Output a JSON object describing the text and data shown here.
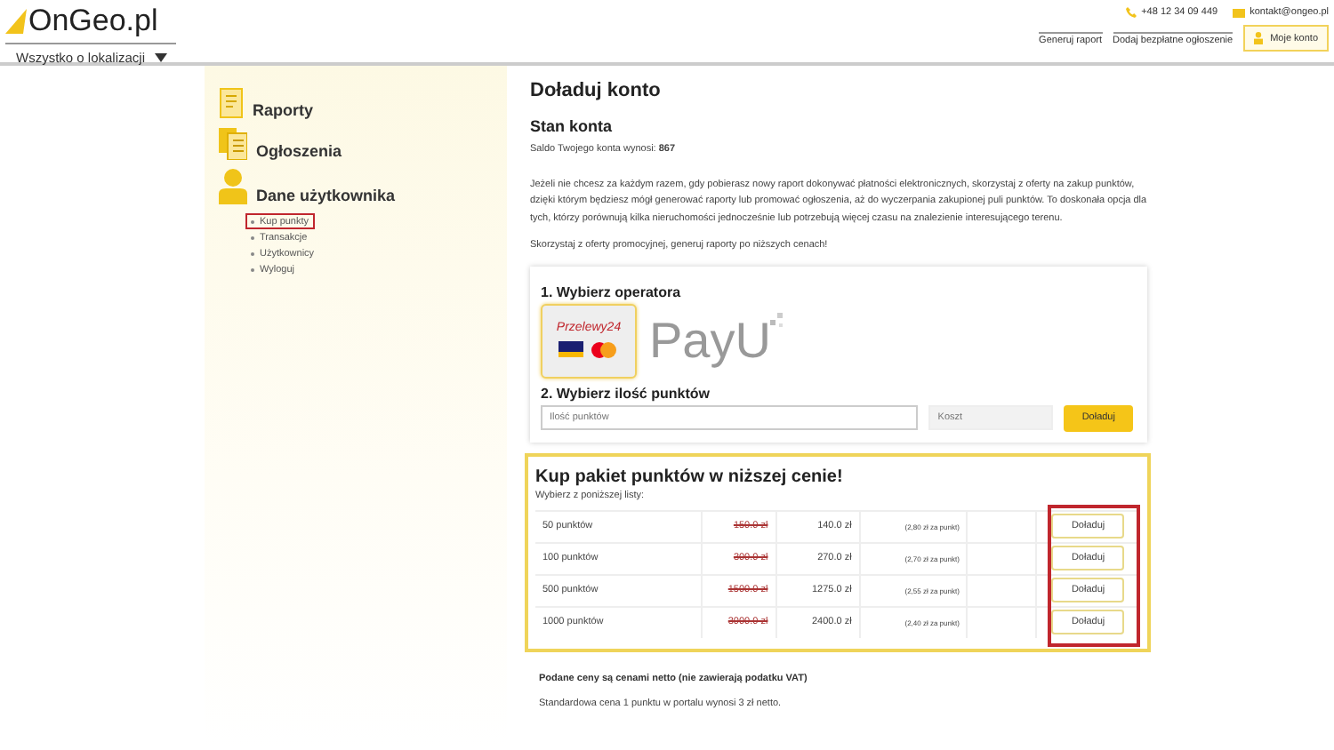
{
  "header": {
    "logo": "OnGeo.pl",
    "dropdown": "Wszystko o lokalizacji",
    "phone": "+48 12 34 09 449",
    "email": "kontakt@ongeo.pl",
    "nav_links": [
      "Generuj raport",
      "Dodaj bezpłatne ogłoszenie"
    ],
    "account_button": "Moje konto"
  },
  "sidebar": {
    "sections": [
      {
        "kind": "report",
        "label": "Raporty"
      },
      {
        "kind": "ads",
        "label": "Ogłoszenia"
      },
      {
        "kind": "user",
        "label": "Dane użytkownika",
        "children": [
          {
            "label": "Kup punkty",
            "selected": true
          },
          {
            "label": "Transakcje",
            "selected": false
          },
          {
            "label": "Użytkownicy",
            "selected": false
          },
          {
            "label": "Wyloguj",
            "selected": false
          }
        ]
      }
    ]
  },
  "content": {
    "title": "Doładuj konto",
    "balance_heading": "Stan konta",
    "balance_text": "Saldo Twojego konta wynosi: **867**",
    "intro": "Jeżeli nie chcesz za każdym razem, gdy pobierasz nowy raport dokonywać płatności elektronicznych, skorzystaj z oferty na zakup punktów, dzięki którym będziesz mógł generować raporty lub promować ogłoszenia, aż do wyczerpania zakupionej puli punktów. To doskonała opcja dla tych, którzy porównują kilka nieruchomości jednocześnie lub potrzebują więcej czasu na znalezienie interesującego terenu.",
    "promo": "Skorzystaj z oferty promocyjnej, generuj raporty po niższych cenach!",
    "step1": "1. Wybierz operatora",
    "operators": [
      {
        "kind": "przelewy24",
        "label": "Przelewy24",
        "selected": true
      },
      {
        "kind": "payu",
        "label": "PayU",
        "selected": false
      }
    ],
    "step2": "2. Wybierz ilość punktów",
    "points_field": {
      "placeholder": "Ilość punktów"
    },
    "cost_field": {
      "placeholder": "Koszt"
    },
    "topup_button": "Doładuj",
    "packages": {
      "title": "Kup pakiet punktów w niższej cenie!",
      "subtitle": "Wybierz z poniższej listy:",
      "buttons_highlighted": true,
      "rows": [
        {
          "points": "50 punktów",
          "old_price": "150.0 zł",
          "price": "140.0 zł",
          "per_point": "(2,80 zł za punkt)",
          "button": "Doładuj"
        },
        {
          "points": "100 punktów",
          "old_price": "300.0 zł",
          "price": "270.0 zł",
          "per_point": "(2,70 zł za punkt)",
          "button": "Doładuj"
        },
        {
          "points": "500 punktów",
          "old_price": "1500.0 zł",
          "price": "1275.0 zł",
          "per_point": "(2,55 zł za punkt)",
          "button": "Doładuj"
        },
        {
          "points": "1000 punktów",
          "old_price": "3000.0 zł",
          "price": "2400.0 zł",
          "per_point": "(2,40 zł za punkt)",
          "button": "Doładuj"
        }
      ]
    },
    "note_bold": "Podane ceny są cenami netto (nie zawierają podatku VAT)",
    "note": "Standardowa cena 1 punktu w portalu wynosi 3 zł netto."
  }
}
